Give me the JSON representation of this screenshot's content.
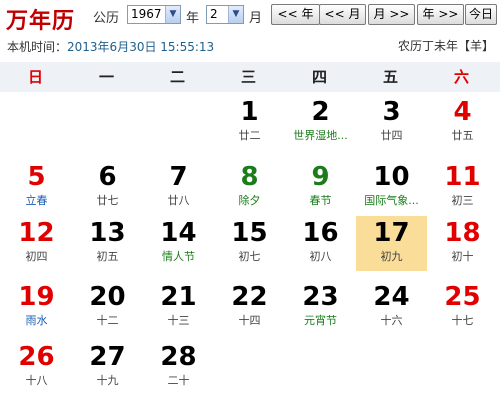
{
  "title": "万年历",
  "toolbar": {
    "calendar_label": "公历",
    "year_value": "1967",
    "year_unit": "年",
    "month_value": "2",
    "month_unit": "月",
    "buttons": [
      "<< 年",
      "<< 月",
      "月 >>",
      "年 >>",
      "今日"
    ]
  },
  "clock": {
    "label": "本机时间：",
    "time": "2013年6月30日 15:55:13"
  },
  "lunar_year": "农历丁未年【羊】",
  "weekdays": [
    "日",
    "一",
    "二",
    "三",
    "四",
    "五",
    "六"
  ],
  "colors": {
    "holiday_red": "#e00000",
    "festival_green": "#1a7d1a",
    "term_blue": "#1a5fb4",
    "today_bg": "#fbdd9a",
    "title_red": "#c00000"
  },
  "days": [
    {
      "d": "1",
      "sub": "廿二",
      "numColor": "black",
      "subColor": "gray"
    },
    {
      "d": "2",
      "sub": "世界湿地...",
      "numColor": "black",
      "subColor": "green"
    },
    {
      "d": "3",
      "sub": "廿四",
      "numColor": "black",
      "subColor": "gray"
    },
    {
      "d": "4",
      "sub": "廿五",
      "numColor": "red",
      "subColor": "gray"
    },
    {
      "d": "5",
      "sub": "立春",
      "numColor": "red",
      "subColor": "blue"
    },
    {
      "d": "6",
      "sub": "廿七",
      "numColor": "black",
      "subColor": "gray"
    },
    {
      "d": "7",
      "sub": "廿八",
      "numColor": "black",
      "subColor": "gray"
    },
    {
      "d": "8",
      "sub": "除夕",
      "numColor": "green",
      "subColor": "green"
    },
    {
      "d": "9",
      "sub": "春节",
      "numColor": "green",
      "subColor": "green"
    },
    {
      "d": "10",
      "sub": "国际气象...",
      "numColor": "black",
      "subColor": "green"
    },
    {
      "d": "11",
      "sub": "初三",
      "numColor": "red",
      "subColor": "gray"
    },
    {
      "d": "12",
      "sub": "初四",
      "numColor": "red",
      "subColor": "gray"
    },
    {
      "d": "13",
      "sub": "初五",
      "numColor": "black",
      "subColor": "gray"
    },
    {
      "d": "14",
      "sub": "情人节",
      "numColor": "black",
      "subColor": "green"
    },
    {
      "d": "15",
      "sub": "初七",
      "numColor": "black",
      "subColor": "gray"
    },
    {
      "d": "16",
      "sub": "初八",
      "numColor": "black",
      "subColor": "gray"
    },
    {
      "d": "17",
      "sub": "初九",
      "numColor": "black",
      "subColor": "gray",
      "today": true
    },
    {
      "d": "18",
      "sub": "初十",
      "numColor": "red",
      "subColor": "gray"
    },
    {
      "d": "19",
      "sub": "雨水",
      "numColor": "red",
      "subColor": "blue"
    },
    {
      "d": "20",
      "sub": "十二",
      "numColor": "black",
      "subColor": "gray"
    },
    {
      "d": "21",
      "sub": "十三",
      "numColor": "black",
      "subColor": "gray"
    },
    {
      "d": "22",
      "sub": "十四",
      "numColor": "black",
      "subColor": "gray"
    },
    {
      "d": "23",
      "sub": "元宵节",
      "numColor": "black",
      "subColor": "green"
    },
    {
      "d": "24",
      "sub": "十六",
      "numColor": "black",
      "subColor": "gray"
    },
    {
      "d": "25",
      "sub": "十七",
      "numColor": "red",
      "subColor": "gray"
    },
    {
      "d": "26",
      "sub": "十八",
      "numColor": "red",
      "subColor": "gray"
    },
    {
      "d": "27",
      "sub": "十九",
      "numColor": "black",
      "subColor": "gray"
    },
    {
      "d": "28",
      "sub": "二十",
      "numColor": "black",
      "subColor": "gray"
    }
  ]
}
